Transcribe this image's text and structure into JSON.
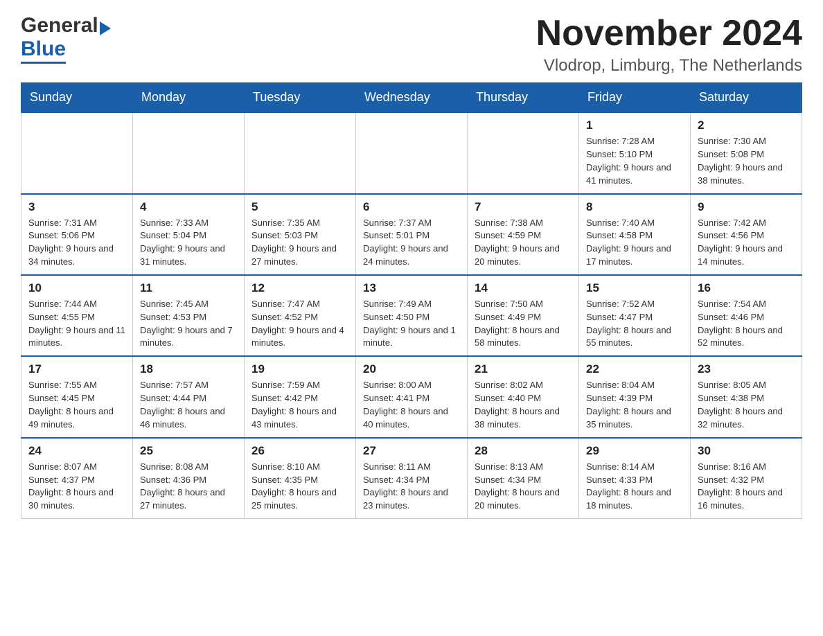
{
  "header": {
    "month_title": "November 2024",
    "location": "Vlodrop, Limburg, The Netherlands",
    "logo_general": "General",
    "logo_blue": "Blue"
  },
  "weekdays": [
    "Sunday",
    "Monday",
    "Tuesday",
    "Wednesday",
    "Thursday",
    "Friday",
    "Saturday"
  ],
  "weeks": [
    {
      "days": [
        {
          "number": "",
          "info": ""
        },
        {
          "number": "",
          "info": ""
        },
        {
          "number": "",
          "info": ""
        },
        {
          "number": "",
          "info": ""
        },
        {
          "number": "",
          "info": ""
        },
        {
          "number": "1",
          "info": "Sunrise: 7:28 AM\nSunset: 5:10 PM\nDaylight: 9 hours and 41 minutes."
        },
        {
          "number": "2",
          "info": "Sunrise: 7:30 AM\nSunset: 5:08 PM\nDaylight: 9 hours and 38 minutes."
        }
      ]
    },
    {
      "days": [
        {
          "number": "3",
          "info": "Sunrise: 7:31 AM\nSunset: 5:06 PM\nDaylight: 9 hours and 34 minutes."
        },
        {
          "number": "4",
          "info": "Sunrise: 7:33 AM\nSunset: 5:04 PM\nDaylight: 9 hours and 31 minutes."
        },
        {
          "number": "5",
          "info": "Sunrise: 7:35 AM\nSunset: 5:03 PM\nDaylight: 9 hours and 27 minutes."
        },
        {
          "number": "6",
          "info": "Sunrise: 7:37 AM\nSunset: 5:01 PM\nDaylight: 9 hours and 24 minutes."
        },
        {
          "number": "7",
          "info": "Sunrise: 7:38 AM\nSunset: 4:59 PM\nDaylight: 9 hours and 20 minutes."
        },
        {
          "number": "8",
          "info": "Sunrise: 7:40 AM\nSunset: 4:58 PM\nDaylight: 9 hours and 17 minutes."
        },
        {
          "number": "9",
          "info": "Sunrise: 7:42 AM\nSunset: 4:56 PM\nDaylight: 9 hours and 14 minutes."
        }
      ]
    },
    {
      "days": [
        {
          "number": "10",
          "info": "Sunrise: 7:44 AM\nSunset: 4:55 PM\nDaylight: 9 hours and 11 minutes."
        },
        {
          "number": "11",
          "info": "Sunrise: 7:45 AM\nSunset: 4:53 PM\nDaylight: 9 hours and 7 minutes."
        },
        {
          "number": "12",
          "info": "Sunrise: 7:47 AM\nSunset: 4:52 PM\nDaylight: 9 hours and 4 minutes."
        },
        {
          "number": "13",
          "info": "Sunrise: 7:49 AM\nSunset: 4:50 PM\nDaylight: 9 hours and 1 minute."
        },
        {
          "number": "14",
          "info": "Sunrise: 7:50 AM\nSunset: 4:49 PM\nDaylight: 8 hours and 58 minutes."
        },
        {
          "number": "15",
          "info": "Sunrise: 7:52 AM\nSunset: 4:47 PM\nDaylight: 8 hours and 55 minutes."
        },
        {
          "number": "16",
          "info": "Sunrise: 7:54 AM\nSunset: 4:46 PM\nDaylight: 8 hours and 52 minutes."
        }
      ]
    },
    {
      "days": [
        {
          "number": "17",
          "info": "Sunrise: 7:55 AM\nSunset: 4:45 PM\nDaylight: 8 hours and 49 minutes."
        },
        {
          "number": "18",
          "info": "Sunrise: 7:57 AM\nSunset: 4:44 PM\nDaylight: 8 hours and 46 minutes."
        },
        {
          "number": "19",
          "info": "Sunrise: 7:59 AM\nSunset: 4:42 PM\nDaylight: 8 hours and 43 minutes."
        },
        {
          "number": "20",
          "info": "Sunrise: 8:00 AM\nSunset: 4:41 PM\nDaylight: 8 hours and 40 minutes."
        },
        {
          "number": "21",
          "info": "Sunrise: 8:02 AM\nSunset: 4:40 PM\nDaylight: 8 hours and 38 minutes."
        },
        {
          "number": "22",
          "info": "Sunrise: 8:04 AM\nSunset: 4:39 PM\nDaylight: 8 hours and 35 minutes."
        },
        {
          "number": "23",
          "info": "Sunrise: 8:05 AM\nSunset: 4:38 PM\nDaylight: 8 hours and 32 minutes."
        }
      ]
    },
    {
      "days": [
        {
          "number": "24",
          "info": "Sunrise: 8:07 AM\nSunset: 4:37 PM\nDaylight: 8 hours and 30 minutes."
        },
        {
          "number": "25",
          "info": "Sunrise: 8:08 AM\nSunset: 4:36 PM\nDaylight: 8 hours and 27 minutes."
        },
        {
          "number": "26",
          "info": "Sunrise: 8:10 AM\nSunset: 4:35 PM\nDaylight: 8 hours and 25 minutes."
        },
        {
          "number": "27",
          "info": "Sunrise: 8:11 AM\nSunset: 4:34 PM\nDaylight: 8 hours and 23 minutes."
        },
        {
          "number": "28",
          "info": "Sunrise: 8:13 AM\nSunset: 4:34 PM\nDaylight: 8 hours and 20 minutes."
        },
        {
          "number": "29",
          "info": "Sunrise: 8:14 AM\nSunset: 4:33 PM\nDaylight: 8 hours and 18 minutes."
        },
        {
          "number": "30",
          "info": "Sunrise: 8:16 AM\nSunset: 4:32 PM\nDaylight: 8 hours and 16 minutes."
        }
      ]
    }
  ]
}
